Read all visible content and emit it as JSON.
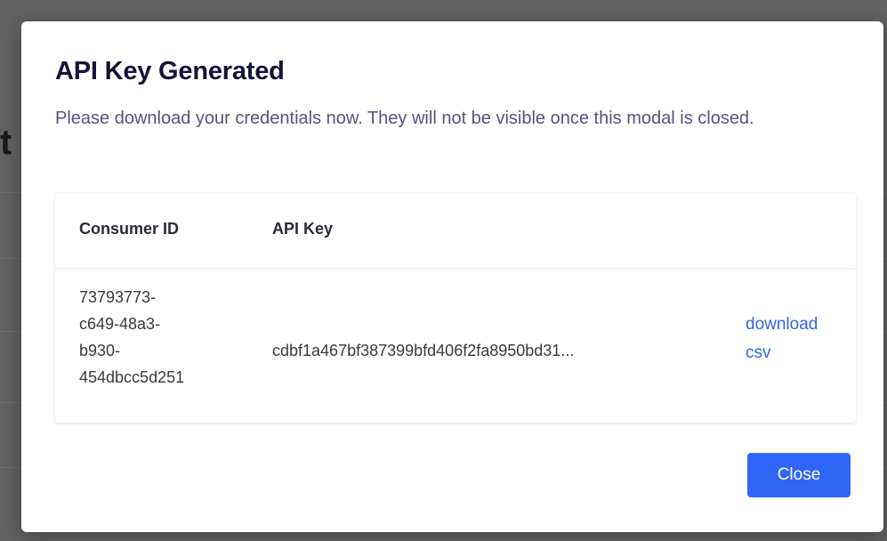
{
  "modal": {
    "title": "API Key Generated",
    "subtitle": "Please download your credentials now. They will not be visible once this modal is closed.",
    "table": {
      "headers": {
        "consumer_id": "Consumer ID",
        "api_key": "API Key"
      },
      "row": {
        "consumer_id_lines": [
          "73793773-",
          "c649-48a3-",
          "b930-",
          "454dbcc5d251"
        ],
        "api_key": "cdbf1a467bf387399bfd406f2fa8950bd31...",
        "download_line1": "download",
        "download_line2": "csv"
      }
    },
    "close_label": "Close"
  },
  "colors": {
    "accent": "#2f66f5",
    "link": "#2f67e6",
    "title": "#16133a",
    "subtitle": "#56557a",
    "overlay": "#626262"
  }
}
